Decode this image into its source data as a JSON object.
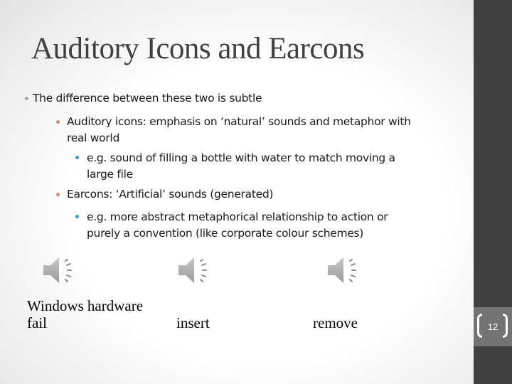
{
  "slide": {
    "title": "Auditory Icons and Earcons",
    "page_number": "12",
    "bullets": [
      {
        "level": 1,
        "text": "The difference between these two is subtle"
      },
      {
        "level": 2,
        "lines": [
          "Auditory icons: emphasis on ‘natural’ sounds and metaphor with",
          "real world"
        ]
      },
      {
        "level": 3,
        "lines": [
          "e.g. sound of filling a bottle with water to match moving a",
          "large file"
        ]
      },
      {
        "level": 2,
        "text": "Earcons: ‘Artificial’ sounds (generated)"
      },
      {
        "level": 3,
        "lines": [
          "e.g. more abstract metaphorical relationship to action or",
          "purely a convention (like corporate colour schemes)"
        ]
      }
    ],
    "sounds": [
      {
        "icon": "speaker-icon",
        "label_lines": [
          "Windows hardware",
          "fail"
        ]
      },
      {
        "icon": "speaker-icon",
        "label_lines": [
          "insert"
        ]
      },
      {
        "icon": "speaker-icon",
        "label_lines": [
          "remove"
        ]
      }
    ]
  },
  "colors": {
    "sidebar": "#404040",
    "page_band": "#737373",
    "bullet_level1": "#a5a5a5",
    "bullet_level2": "#d18a5c",
    "bullet_level3": "#3b9cc4"
  }
}
